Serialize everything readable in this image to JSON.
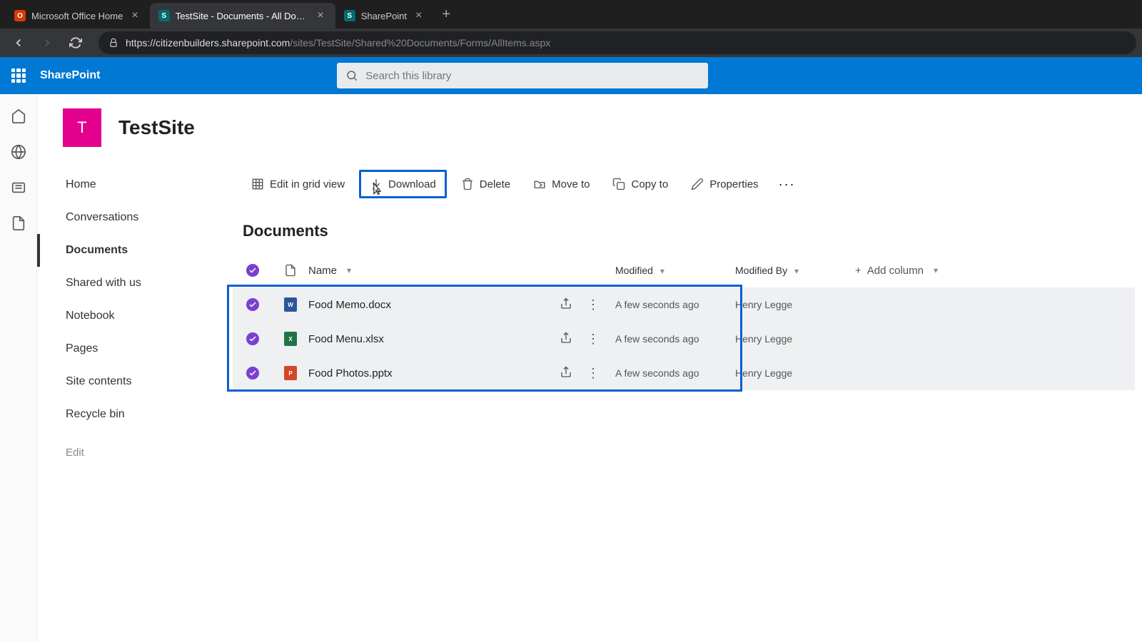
{
  "browser": {
    "tabs": [
      {
        "title": "Microsoft Office Home",
        "icon_bg": "#d83b01",
        "icon_text": "O",
        "active": false
      },
      {
        "title": "TestSite - Documents - All Docum",
        "icon_bg": "#036c70",
        "icon_text": "S",
        "active": true
      },
      {
        "title": "SharePoint",
        "icon_bg": "#036c70",
        "icon_text": "S",
        "active": false
      }
    ],
    "url_host": "https://citizenbuilders.sharepoint.com",
    "url_path": "/sites/TestSite/Shared%20Documents/Forms/AllItems.aspx"
  },
  "suite": {
    "brand": "SharePoint",
    "search_placeholder": "Search this library"
  },
  "site": {
    "logo_letter": "T",
    "title": "TestSite"
  },
  "nav": {
    "items": [
      "Home",
      "Conversations",
      "Documents",
      "Shared with us",
      "Notebook",
      "Pages",
      "Site contents",
      "Recycle bin"
    ],
    "edit": "Edit",
    "active_index": 2
  },
  "actions": {
    "grid": "Edit in grid view",
    "download": "Download",
    "delete": "Delete",
    "moveto": "Move to",
    "copyto": "Copy to",
    "properties": "Properties"
  },
  "library": {
    "title": "Documents",
    "columns": {
      "name": "Name",
      "modified": "Modified",
      "modifiedby": "Modified By",
      "add": "Add column"
    },
    "rows": [
      {
        "name": "Food Memo.docx",
        "type": "word",
        "type_label": "W",
        "modified": "A few seconds ago",
        "modifiedby": "Henry Legge"
      },
      {
        "name": "Food Menu.xlsx",
        "type": "excel",
        "type_label": "X",
        "modified": "A few seconds ago",
        "modifiedby": "Henry Legge"
      },
      {
        "name": "Food Photos.pptx",
        "type": "ppt",
        "type_label": "P",
        "modified": "A few seconds ago",
        "modifiedby": "Henry Legge"
      }
    ]
  }
}
